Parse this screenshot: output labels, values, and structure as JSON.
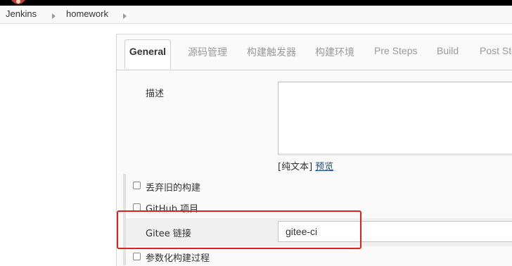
{
  "breadcrumb": {
    "items": [
      {
        "label": "Jenkins"
      },
      {
        "label": "homework"
      }
    ]
  },
  "tabs": [
    {
      "label": "General",
      "active": true
    },
    {
      "label": "源码管理"
    },
    {
      "label": "构建触发器"
    },
    {
      "label": "构建环境"
    },
    {
      "label": "Pre Steps"
    },
    {
      "label": "Build"
    },
    {
      "label": "Post Ste"
    }
  ],
  "form": {
    "description_label": "描述",
    "description_value": "",
    "plain_text": "[纯文本]",
    "preview_link": "预览",
    "options": [
      {
        "label": "丢弃旧的构建",
        "checked": false
      },
      {
        "label": "GitHub 项目",
        "checked": false
      },
      {
        "label": "参数化构建过程",
        "checked": false
      }
    ],
    "gitee_label": "Gitee 链接",
    "gitee_value": "gitee-ci"
  },
  "colors": {
    "highlight": "#e02020",
    "link": "#204a87"
  }
}
